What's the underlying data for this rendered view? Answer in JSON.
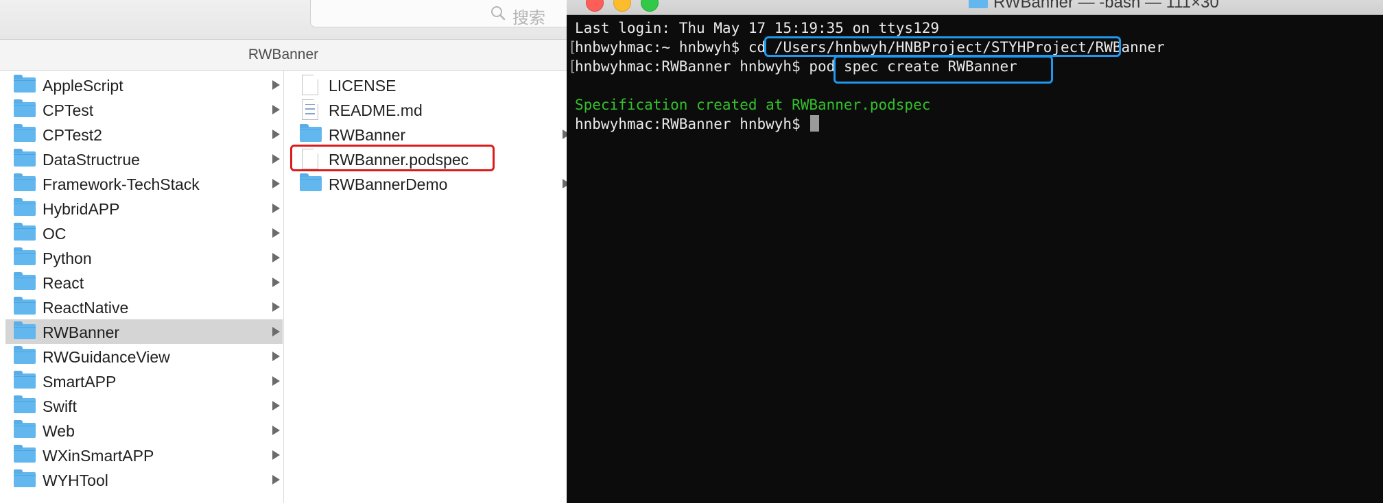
{
  "finder": {
    "search_placeholder": "搜索",
    "path_title": "RWBanner",
    "column1": [
      {
        "label": "AppleScript",
        "type": "folder"
      },
      {
        "label": "CPTest",
        "type": "folder"
      },
      {
        "label": "CPTest2",
        "type": "folder"
      },
      {
        "label": "DataStructrue",
        "type": "folder"
      },
      {
        "label": "Framework-TechStack",
        "type": "folder"
      },
      {
        "label": "HybridAPP",
        "type": "folder"
      },
      {
        "label": "OC",
        "type": "folder"
      },
      {
        "label": "Python",
        "type": "folder"
      },
      {
        "label": "React",
        "type": "folder"
      },
      {
        "label": "ReactNative",
        "type": "folder"
      },
      {
        "label": "RWBanner",
        "type": "folder",
        "selected": true
      },
      {
        "label": "RWGuidanceView",
        "type": "folder"
      },
      {
        "label": "SmartAPP",
        "type": "folder"
      },
      {
        "label": "Swift",
        "type": "folder"
      },
      {
        "label": "Web",
        "type": "folder"
      },
      {
        "label": "WXinSmartAPP",
        "type": "folder"
      },
      {
        "label": "WYHTool",
        "type": "folder"
      }
    ],
    "column2": [
      {
        "label": "LICENSE",
        "type": "file"
      },
      {
        "label": "README.md",
        "type": "text-file"
      },
      {
        "label": "RWBanner",
        "type": "folder"
      },
      {
        "label": "RWBanner.podspec",
        "type": "file",
        "highlighted": true
      },
      {
        "label": "RWBannerDemo",
        "type": "folder"
      }
    ]
  },
  "terminal": {
    "title": "RWBanner — -bash — 111×30",
    "lines": {
      "login": "Last login: Thu May 17 15:19:35 on ttys129",
      "prompt1": "hnbwyhmac:~ hnbwyh$ ",
      "cmd1": "cd /Users/hnbwyh/HNBProject/STYHProject/RWBanner",
      "prompt2": "hnbwyhmac:RWBanner hnbwyh$ ",
      "cmd2": "pod spec create RWBanner",
      "output": "Specification created at RWBanner.podspec",
      "prompt3": "hnbwyhmac:RWBanner hnbwyh$ "
    }
  },
  "colors": {
    "folder_blue": "#63b7ef",
    "highlight_red": "#dd1a1a",
    "highlight_blue": "#1f98f0",
    "terminal_green": "#33c12b",
    "terminal_bg": "#0c0c0c"
  },
  "icons": {
    "search": "magnifier-icon",
    "folder": "folder-icon",
    "file": "document-icon",
    "chevron": "chevron-right-icon"
  }
}
